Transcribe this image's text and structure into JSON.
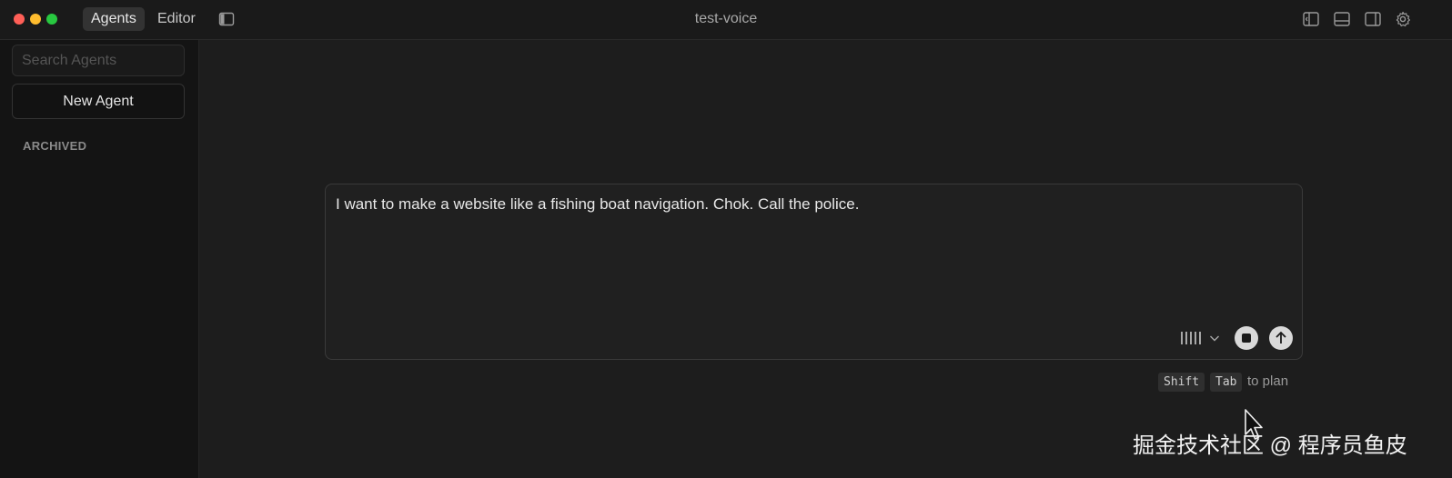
{
  "titlebar": {
    "tabs": [
      {
        "label": "Agents",
        "active": true
      },
      {
        "label": "Editor",
        "active": false
      }
    ],
    "window_title": "test-voice",
    "icons": [
      "sidebar-left-icon",
      "panel-left-icon",
      "panel-bottom-icon",
      "panel-right-icon",
      "settings-gear-icon"
    ]
  },
  "sidebar": {
    "search_placeholder": "Search Agents",
    "new_agent_label": "New Agent",
    "archived_heading": "ARCHIVED"
  },
  "composer": {
    "text": "I want to make a website like a fishing boat navigation. Chok. Call the police.",
    "icons": [
      "waveform-icon",
      "chevron-down-icon",
      "stop-icon",
      "send-arrow-icon"
    ]
  },
  "hint": {
    "key1": "Shift",
    "key2": "Tab",
    "text": "to plan"
  },
  "watermark": "掘金技术社区 @ 程序员鱼皮",
  "colors": {
    "background": "#1d1d1d",
    "sidebar": "#141414",
    "traffic_red": "#ff5f57",
    "traffic_yellow": "#febc2e",
    "traffic_green": "#28c840"
  }
}
